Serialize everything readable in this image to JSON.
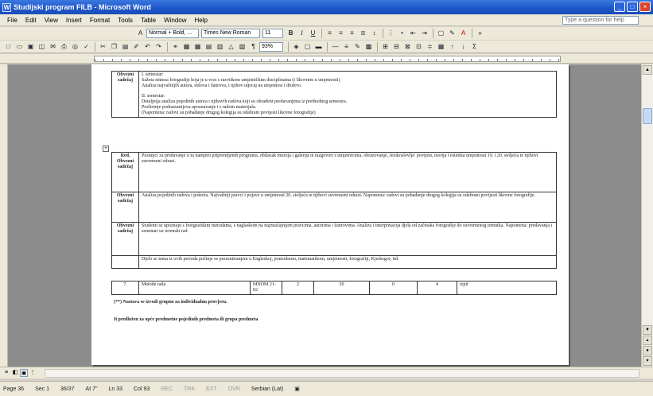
{
  "window": {
    "title": "Studijski program FILB - Microsoft Word",
    "controls": [
      "_",
      "□",
      "×"
    ]
  },
  "menu": {
    "items": [
      "File",
      "Edit",
      "View",
      "Insert",
      "Format",
      "Tools",
      "Table",
      "Window",
      "Help"
    ],
    "help_box": "Type a question for help"
  },
  "formatting_toolbar": {
    "style": "Normal + Bold, ...",
    "font": "Times New Roman",
    "size": "11"
  },
  "standard_toolbar": {
    "zoom": "93%"
  },
  "document": {
    "row1": {
      "label": "Obvezni sadržaj",
      "lines": [
        "I. semestar:",
        "Sažeta sinteza fotografije koja je u vezi s razvitkom umjetničkim disciplinama (i likovnim u umjetnosti)",
        "Analiza najvažnijih autora, stilova i žanrova, i njihov utjecaj na umjetnost i društvo.",
        "II. semestar:",
        "Detaljnija analiza pojedinih autora i njihovih radova koji su obrađeni predavanjima iz prethodnog semestra.",
        "Proširenje podrazumijeva upoznavanje i s radom materijala.",
        "(Napomena: radovi su pohađanje drugog kolegija su odabrani povijesti likovne fotografije)"
      ]
    },
    "row2": {
      "label": "Red. Obvezni sadržaj",
      "text": "Postupci za predavanje u tu namjeru pripremljenih programa, obilazak muzeja i galerija te razgovori s umjetnicima, obrazovanje, Jezikoslovlje: povijest, teorija i estetika umjetnosti 19. i 20. stoljeća te njihovi suvremeni odrazi."
    },
    "row3": {
      "label": "Obvezni sadržaj",
      "text": "Analiza pojedinih radova i pokreta. Najvažniji pravci i pojave u umjetnosti 20. stoljeća te njihovi suvremeni odrazi. Napomena: radovi su pohađanje drugog kolegija su odabrani povijesti likovne fotografije."
    },
    "row4": {
      "label": "Obvezni sadržaj",
      "text": "Studenti se upoznaju s fotografskim metodama, s naglaskom na najznačajnijim pravcima, autorima i žanrovima. Analiza i interpretacija djela od začetaka fotografije do suvremenog trenutka. Napomena: predavanja i seminari uz terenski rad."
    },
    "row5": {
      "label": "",
      "text": "Djelo se tema iz ovih perioda počinje se prezentiranjem u Engleskoj, pomodnom, matematikom, umjetnosti, fotografiji, Kjerkegor, itd."
    },
    "last_row": {
      "num": "7.",
      "name": "Metode rada",
      "code": "MNOM 21-02",
      "c1": "2",
      "c2": "20",
      "c3": "0",
      "c4": "4",
      "type": "izpit"
    },
    "footnote1": "(**) Nastava se izvodi grupno za individualnu provjeru.",
    "footnote2": "Ii predložen za opće predmetne pojedinih predmeta ili grupa predmeta"
  },
  "statusbar": {
    "page": "Page 36",
    "sec": "Sec 1",
    "pos": "36/37",
    "at": "At 7\"",
    "ln": "Ln 33",
    "col": "Col 93",
    "rec": "REC",
    "trk": "TRK",
    "ext": "EXT",
    "ovr": "OVR",
    "lang": "Serbian (Lat)"
  }
}
